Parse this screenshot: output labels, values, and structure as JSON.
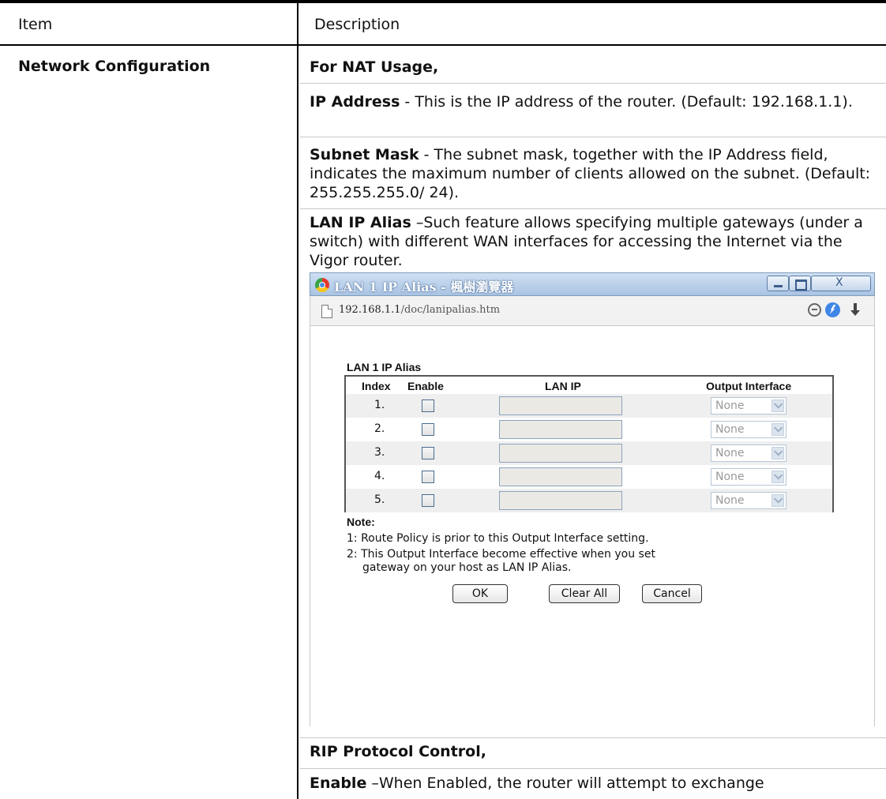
{
  "table": {
    "header": {
      "item": "Item",
      "description": "Description"
    },
    "row_item": "Network Configuration",
    "nat_usage": "For NAT Usage,",
    "ip_address": {
      "term": "IP Address",
      "text": " - This is the IP address of the router. (Default: 192.168.1.1)."
    },
    "subnet_mask": {
      "term": "Subnet Mask",
      "text": " - The subnet mask, together with the IP Address field, indicates the maximum number of clients allowed on the subnet. (Default: 255.255.255.0/ 24)."
    },
    "lan_ip_alias": {
      "term": "LAN IP Alias",
      "text": " –Such feature allows specifying multiple gateways (under a switch) with different WAN interfaces for accessing the Internet via the Vigor router."
    },
    "rip": "RIP Protocol Control,",
    "enable": {
      "term": "Enable",
      "text": " –When Enabled, the router will attempt to exchange"
    }
  },
  "popup": {
    "window_title": "LAN 1 IP Alias - 楓樹瀏覽器",
    "url_host": "192.168.1.1",
    "url_path": "/doc/lanipalias.htm",
    "section_title": "LAN 1 IP Alias",
    "columns": {
      "index": "Index",
      "enable": "Enable",
      "lan_ip": "LAN IP",
      "output": "Output Interface"
    },
    "rows": [
      {
        "index": "1.",
        "output": "None"
      },
      {
        "index": "2.",
        "output": "None"
      },
      {
        "index": "3.",
        "output": "None"
      },
      {
        "index": "4.",
        "output": "None"
      },
      {
        "index": "5.",
        "output": "None"
      }
    ],
    "note_title": "Note:",
    "note1": "1: Route Policy is prior to this Output Interface setting.",
    "note2a": "2: This Output Interface become effective when you set",
    "note2b": "gateway on your host as LAN IP Alias.",
    "buttons": {
      "ok": "OK",
      "clear": "Clear All",
      "cancel": "Cancel"
    }
  }
}
